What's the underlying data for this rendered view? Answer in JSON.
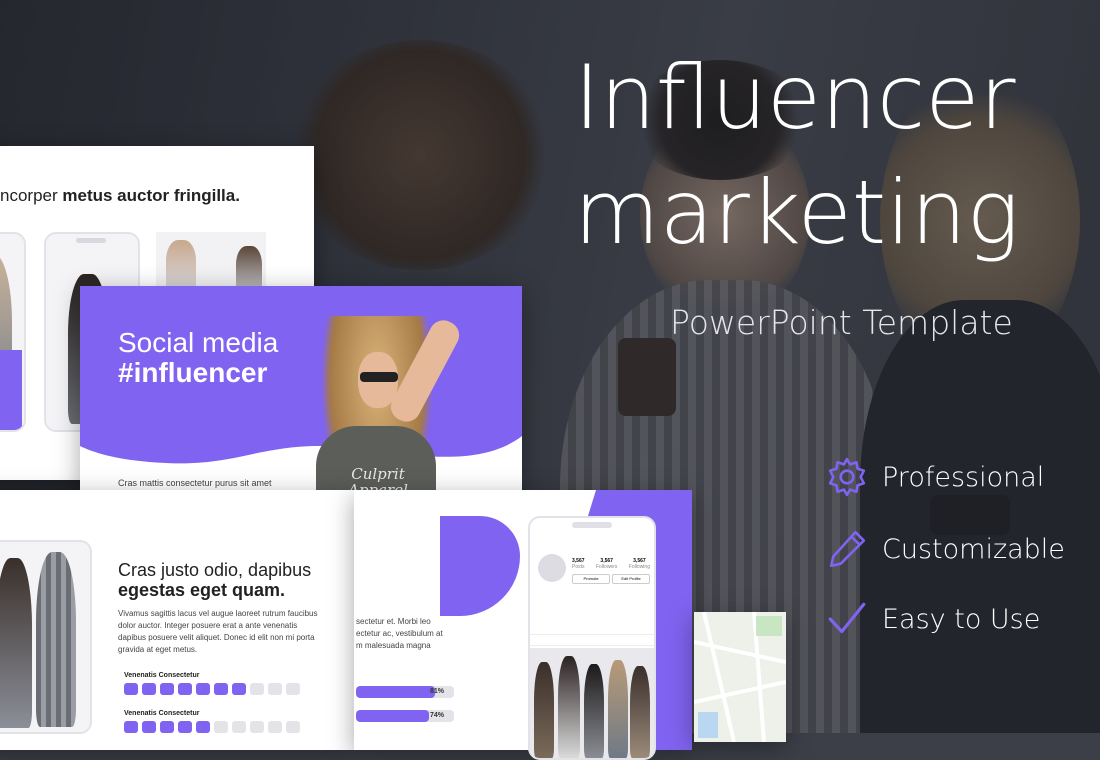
{
  "hero": {
    "title_line1": "Influencer",
    "title_line2": "marketing",
    "subtitle": "PowerPoint Template"
  },
  "features": [
    {
      "icon": "gear-icon",
      "label": "Professional"
    },
    {
      "icon": "pencil-icon",
      "label": "Customizable"
    },
    {
      "icon": "checkmark-icon",
      "label": "Easy to Use"
    }
  ],
  "slide_top": {
    "heading_light": "ncorper ",
    "heading_bold": "metus auctor fringilla."
  },
  "slide_main": {
    "title_line1": "Social media",
    "title_line2": "#influencer",
    "caption": "Cras mattis consectetur purus sit amet",
    "shirt_text": "Culprit Apparel"
  },
  "slide_bottom": {
    "heading_light": "Cras justo odio, dapibus",
    "heading_bold": "egestas eget quam.",
    "body": "Vivamus sagittis lacus vel augue laoreet rutrum faucibus dolor auctor. Integer posuere erat a ante venenatis dapibus posuere velit aliquet. Donec id elit non mi porta gravida at eget metus.",
    "rows": [
      {
        "label": "Venenatis Consectetur",
        "filled": 7,
        "total": 10
      },
      {
        "label": "Venenatis Consectetur",
        "filled": 5,
        "total": 10
      }
    ]
  },
  "slide_mid": {
    "text_line1": "sectetur et. Morbi leo",
    "text_line2": "ectetur ac, vestibulum at",
    "text_line3": "m malesuada magna",
    "bar1": {
      "value": 0.81,
      "label": "81%"
    },
    "bar2": {
      "value": 0.74,
      "label": "74%"
    }
  },
  "profile_phone": {
    "stats": [
      {
        "value": "3,567",
        "label": "Posts"
      },
      {
        "value": "3,567",
        "label": "Followers"
      },
      {
        "value": "3,567",
        "label": "Following"
      }
    ],
    "btn_promote": "Promote",
    "btn_edit": "Edit Profile"
  },
  "colors": {
    "accent": "#8063f0",
    "background": "#3c3f48",
    "text_white": "#ffffff"
  }
}
